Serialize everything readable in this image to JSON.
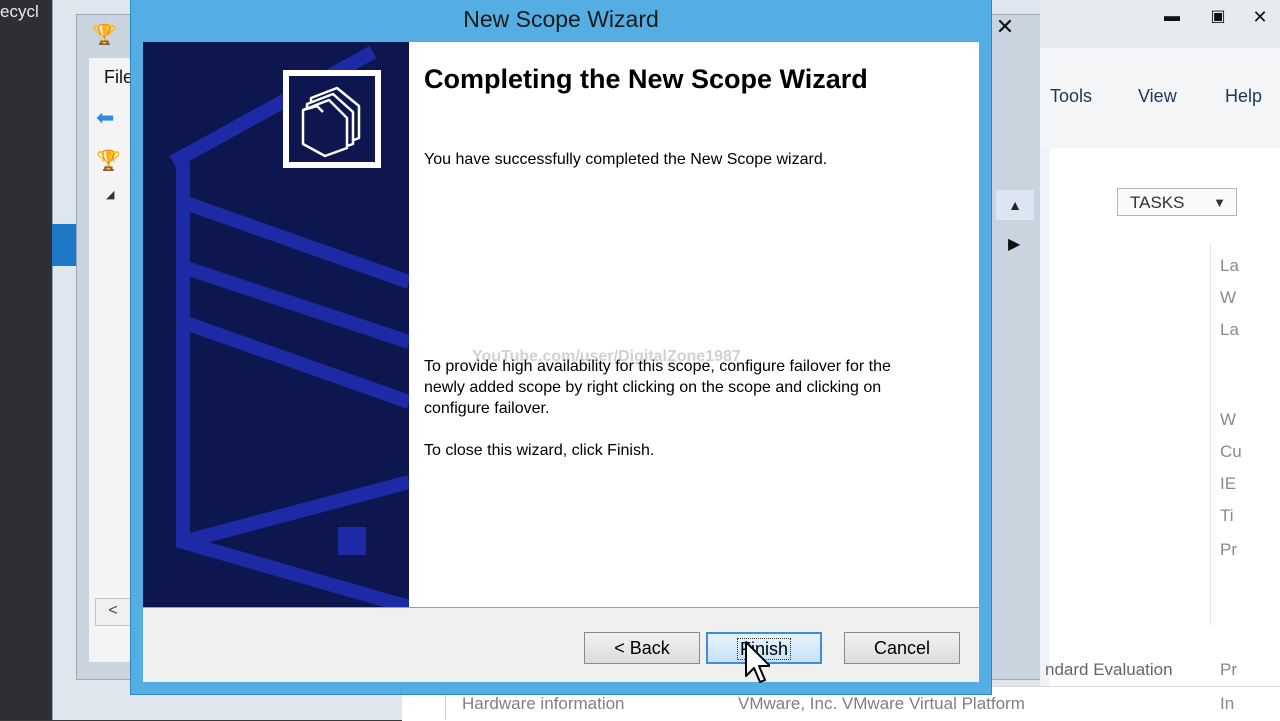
{
  "desktop": {
    "label": "ecycl"
  },
  "mmc": {
    "menu_file": "File",
    "close_glyph": "✕",
    "scroll_up_glyph": "▲",
    "expand_glyph": "▶",
    "hscroll_left_glyph": "<",
    "back_glyph": "⬅",
    "tree_tri_glyph": "◢"
  },
  "server_manager": {
    "title_min": "▬",
    "title_max": "▣",
    "title_close": "✕",
    "menus": {
      "tools": "Tools",
      "view": "View",
      "help": "Help"
    },
    "tasks_label": "TASKS",
    "tasks_caret": "▼",
    "fragments": [
      "La",
      "W",
      "La",
      "W",
      "Cu",
      "IE",
      "Ti",
      "Pr"
    ],
    "eval_text": "ndard Evaluation",
    "pr2_text": "Pr",
    "hw_label": "Hardware information",
    "hw_value": "VMware, Inc. VMware Virtual Platform",
    "in_text": "In"
  },
  "dialog": {
    "title": "New Scope Wizard",
    "heading": "Completing the New Scope Wizard",
    "paragraph1": "You have successfully completed the New Scope wizard.",
    "paragraph2": "To provide high availability for this scope, configure failover for the newly added scope by right clicking on the scope and clicking on configure failover.",
    "paragraph3": "To close this wizard, click Finish.",
    "watermark": "YouTube.com/user/DigitalZone1987",
    "buttons": {
      "back": "< Back",
      "finish": "Finish",
      "cancel": "Cancel"
    }
  },
  "colors": {
    "dialog_frame": "#54aee3",
    "banner": "#0e1650",
    "banner_accent": "#1c2aa5"
  }
}
